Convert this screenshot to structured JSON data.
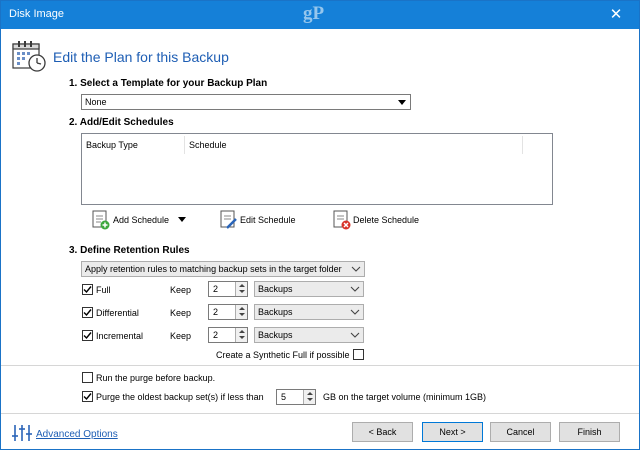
{
  "window": {
    "title": "Disk Image",
    "watermark": "gP",
    "close_glyph": "✕"
  },
  "header": {
    "title": "Edit the Plan for this Backup",
    "icon": "calendar-clock-icon"
  },
  "section1": {
    "label": "1. Select a Template for your Backup Plan",
    "template_value": "None"
  },
  "section2": {
    "label": "2. Add/Edit Schedules",
    "columns": [
      "Backup Type",
      "Schedule"
    ],
    "rows": [],
    "buttons": {
      "add": "Add Schedule",
      "edit": "Edit Schedule",
      "delete": "Delete Schedule"
    }
  },
  "section3": {
    "label": "3. Define Retention Rules",
    "rule_option": "Apply retention rules to matching backup sets in the target folder",
    "keep_label": "Keep",
    "rules": [
      {
        "name": "Full",
        "checked": true,
        "keep": "2",
        "unit": "Backups"
      },
      {
        "name": "Differential",
        "checked": true,
        "keep": "2",
        "unit": "Backups"
      },
      {
        "name": "Incremental",
        "checked": true,
        "keep": "2",
        "unit": "Backups"
      }
    ],
    "synthetic_full": {
      "label": "Create a Synthetic Full if possible",
      "checked": false
    }
  },
  "purge": {
    "run_before": {
      "label": "Run the purge before backup.",
      "checked": false
    },
    "oldest": {
      "label": "Purge the oldest backup set(s) if less than",
      "checked": true,
      "value": "5",
      "suffix": "GB on the target volume (minimum 1GB)"
    }
  },
  "footer": {
    "advanced_options": "Advanced Options",
    "back": "< Back",
    "next": "Next >",
    "cancel": "Cancel",
    "finish": "Finish"
  },
  "colors": {
    "titlebar": "#1580d8",
    "accent": "#1e5eb4"
  }
}
